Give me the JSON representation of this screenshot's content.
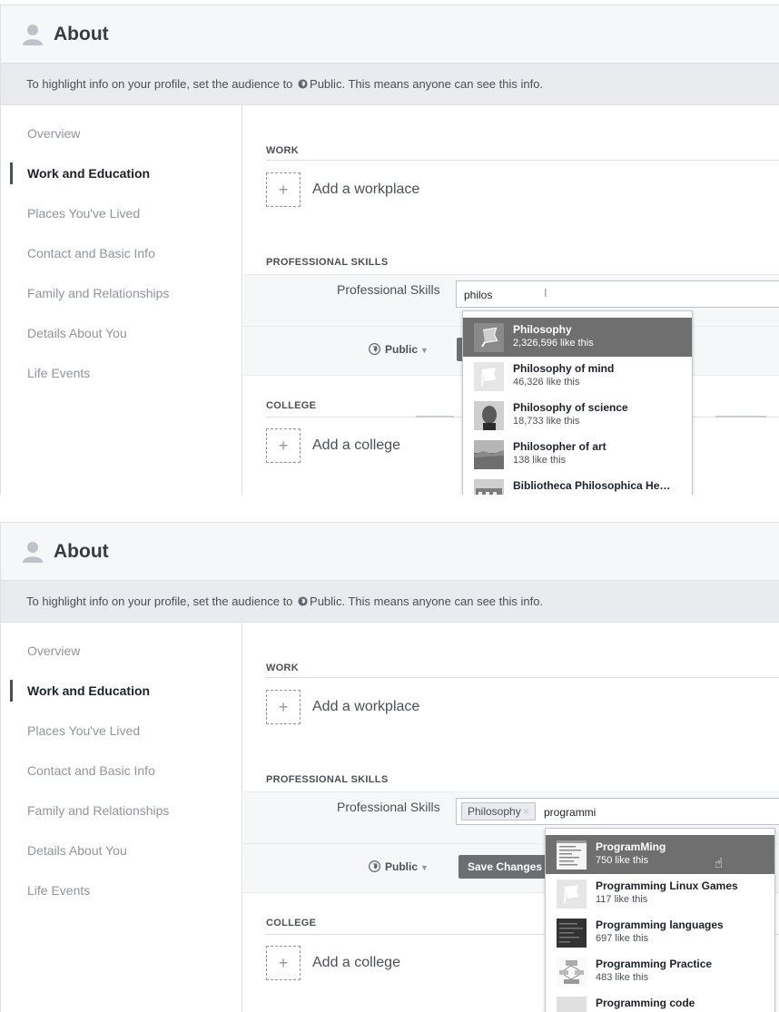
{
  "colors": {
    "selected_bg": "#6f6f6f",
    "save_bg": "#6b6e73",
    "header_bg": "#f6f7f9",
    "notice_bg": "#e9ebee"
  },
  "icons": {
    "about": "person-icon",
    "public": "globe-icon",
    "add": "plus-icon",
    "hand": "hand-pointer-icon"
  },
  "panels": [
    {
      "header": {
        "title": "About"
      },
      "notice": {
        "prefix": "To highlight info on your profile, set the audience to ",
        "audience": "Public",
        "suffix": ". This means anyone can see this info."
      },
      "sidebar": {
        "items": [
          "Overview",
          "Work and Education",
          "Places You've Lived",
          "Contact and Basic Info",
          "Family and Relationships",
          "Details About You",
          "Life Events"
        ],
        "active_index": 1
      },
      "work": {
        "label": "WORK",
        "add_label": "Add a workplace",
        "plus": "+"
      },
      "skills": {
        "section_label": "PROFESSIONAL SKILLS",
        "field_label": "Professional Skills",
        "input_value": "philos",
        "token": ""
      },
      "privacy": {
        "audience": "Public",
        "save_label": ""
      },
      "college": {
        "label": "COLLEGE",
        "add_label": "Add a college",
        "plus": "+"
      },
      "dropdown": [
        {
          "name": "Philosophy",
          "likes": "2,326,596 like this",
          "selected": true
        },
        {
          "name": "Philosophy of mind",
          "likes": "46,326 like this"
        },
        {
          "name": "Philosophy of science",
          "likes": "18,733 like this"
        },
        {
          "name": "Philosopher of art",
          "likes": "138 like this"
        },
        {
          "name": "Bibliotheca Philosophica He…",
          "likes": ""
        }
      ]
    },
    {
      "header": {
        "title": "About"
      },
      "notice": {
        "prefix": "To highlight info on your profile, set the audience to ",
        "audience": "Public",
        "suffix": ". This means anyone can see this info."
      },
      "sidebar": {
        "items": [
          "Overview",
          "Work and Education",
          "Places You've Lived",
          "Contact and Basic Info",
          "Family and Relationships",
          "Details About You",
          "Life Events"
        ],
        "active_index": 1
      },
      "work": {
        "label": "WORK",
        "add_label": "Add a workplace",
        "plus": "+"
      },
      "skills": {
        "section_label": "PROFESSIONAL SKILLS",
        "field_label": "Professional Skills",
        "input_value": "programmi",
        "token": "Philosophy",
        "token_remove": "×"
      },
      "privacy": {
        "audience": "Public",
        "save_label": "Save Changes"
      },
      "college": {
        "label": "COLLEGE",
        "add_label": "Add a college",
        "plus": "+"
      },
      "dropdown": [
        {
          "name": "ProgramMing",
          "likes": "750 like this",
          "selected": true
        },
        {
          "name": "Programming Linux Games",
          "likes": "117 like this"
        },
        {
          "name": "Programming languages",
          "likes": "697 like this"
        },
        {
          "name": "Programming Practice",
          "likes": "483 like this"
        },
        {
          "name": "Programming code",
          "likes": ""
        }
      ]
    }
  ]
}
